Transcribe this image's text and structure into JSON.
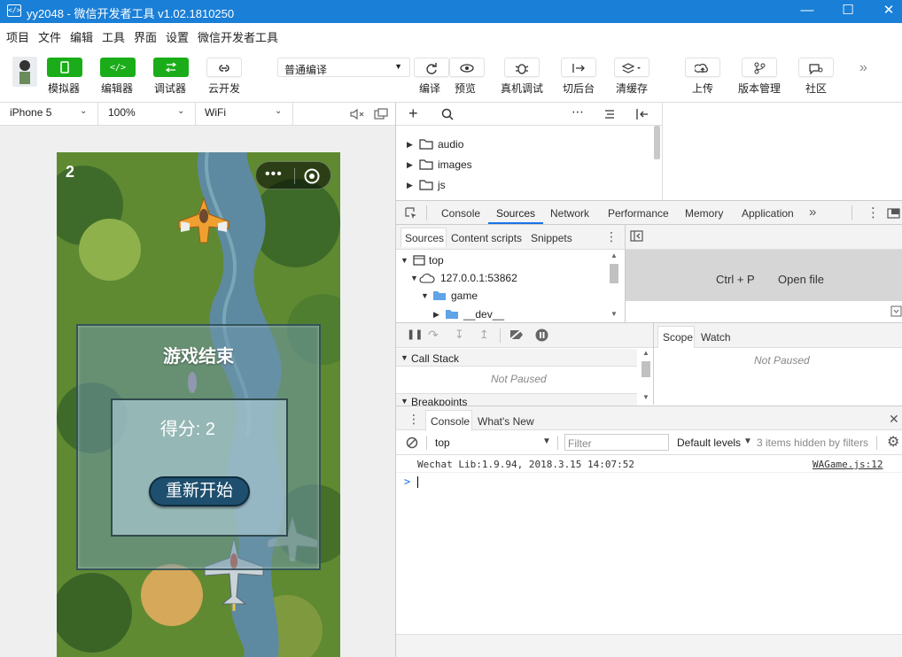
{
  "window": {
    "title": "yy2048 - 微信开发者工具 v1.02.1810250",
    "icon": "</>"
  },
  "menu": [
    "项目",
    "文件",
    "编辑",
    "工具",
    "界面",
    "设置",
    "微信开发者工具"
  ],
  "toolbar": {
    "simulator": "模拟器",
    "editor": "编辑器",
    "debugger": "调试器",
    "cloud": "云开发",
    "compile_mode": "普通编译",
    "compile": "编译",
    "preview": "预览",
    "remote_debug": "真机调试",
    "background": "切后台",
    "clear_cache": "清缓存",
    "upload": "上传",
    "version": "版本管理",
    "community": "社区"
  },
  "device": {
    "model": "iPhone 5",
    "zoom": "100%",
    "network": "WiFi"
  },
  "game": {
    "score_top": "2",
    "game_over": "游戏结束",
    "score_label": "得分: 2",
    "restart": "重新开始"
  },
  "file_tree": [
    "audio",
    "images",
    "js"
  ],
  "devtools": {
    "tabs": [
      "Console",
      "Sources",
      "Network",
      "Performance",
      "Memory",
      "Application"
    ],
    "active_tab": "Sources",
    "sources_subtabs": [
      "Sources",
      "Content scripts",
      "Snippets"
    ],
    "nav_tree": {
      "top": "top",
      "host": "127.0.0.1:53862",
      "folder": "game",
      "sub": "__dev__"
    },
    "shortcut": "Ctrl + P",
    "open_file": "Open file",
    "call_stack": "Call Stack",
    "not_paused": "Not Paused",
    "breakpoints": "Breakpoints",
    "scope": "Scope",
    "watch": "Watch"
  },
  "console": {
    "tabs": [
      "Console",
      "What's New"
    ],
    "context": "top",
    "filter_placeholder": "Filter",
    "levels": "Default levels",
    "hidden": "3 items hidden by filters",
    "log_message": "Wechat Lib:1.9.94, 2018.3.15 14:07:52",
    "log_source": "WAGame.js:12",
    "prompt": ">"
  },
  "colors": {
    "titlebar": "#1a7fd6",
    "green": "#1aad19",
    "accent_tab": "#1a73e8"
  }
}
